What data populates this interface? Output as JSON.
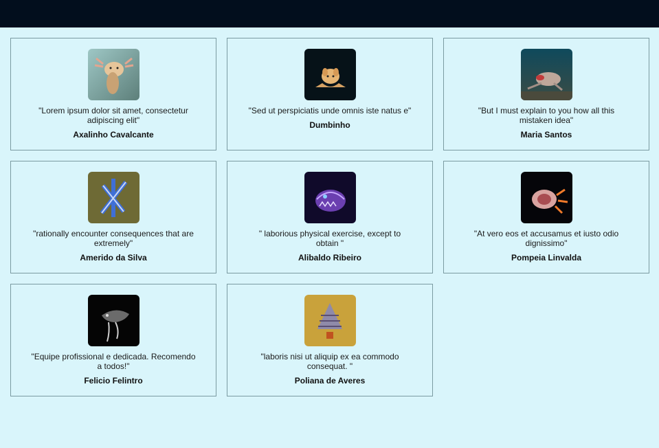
{
  "testimonials": [
    {
      "quote": "\"Lorem ipsum dolor sit amet, consectetur adipiscing elit\"",
      "name": "Axalinho Cavalcante",
      "photo": "axolotl"
    },
    {
      "quote": "\"Sed ut perspiciatis unde omnis iste natus e\"",
      "name": "Dumbinho",
      "photo": "dumbo-octopus"
    },
    {
      "quote": "\"But I must explain to you how all this mistaken idea\"",
      "name": "Maria Santos",
      "photo": "red-lipped-batfish"
    },
    {
      "quote": "\"rationally encounter consequences that are extremely\"",
      "name": "Amerido da Silva",
      "photo": "blue-dragon"
    },
    {
      "quote": "\" laborious physical exercise, except to obtain \"",
      "name": "Alibaldo Ribeiro",
      "photo": "deep-sea-fish"
    },
    {
      "quote": "\"At vero eos et accusamus et iusto odio dignissimo\"",
      "name": "Pompeia Linvalda",
      "photo": "nudibranch"
    },
    {
      "quote": "\"Equipe profissional e dedicada. Recomendo a todos!\"",
      "name": "Felicio Felintro",
      "photo": "barreleye-fish"
    },
    {
      "quote": "\"laboris nisi ut aliquip ex ea commodo consequat. \"",
      "name": "Poliana de Averes",
      "photo": "christmas-tree-worm"
    }
  ]
}
